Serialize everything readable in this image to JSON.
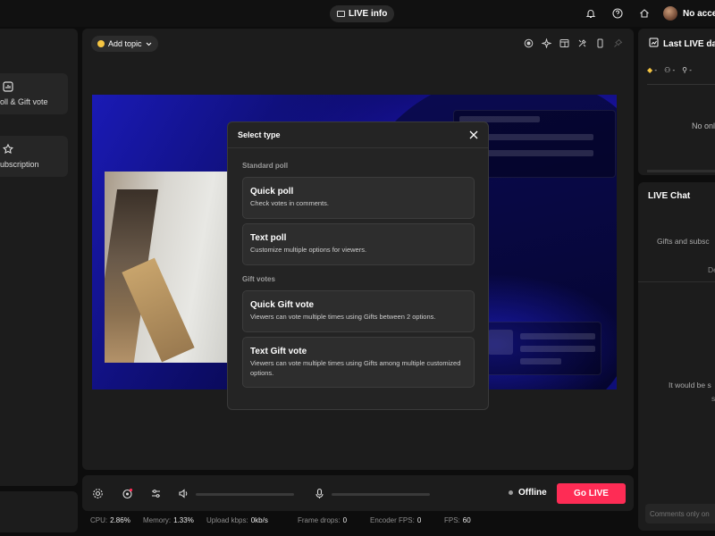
{
  "topbar": {
    "live_info_label": "LIVE info",
    "user_name": "No access"
  },
  "left_panel": {
    "items": [
      {
        "label": "oll & Gift vote",
        "icon": "poll-icon"
      },
      {
        "label": "ubscription",
        "icon": "subscription-icon"
      }
    ]
  },
  "center": {
    "add_topic_label": "Add topic",
    "tools": [
      "record-icon",
      "sparkle-icon",
      "layout-icon",
      "tools-icon",
      "phone-icon",
      "pin-icon"
    ]
  },
  "modal": {
    "title": "Select type",
    "sections": [
      {
        "label": "Standard poll",
        "options": [
          {
            "title": "Quick poll",
            "desc": "Check votes in comments."
          },
          {
            "title": "Text poll",
            "desc": "Customize multiple options for viewers."
          }
        ]
      },
      {
        "label": "Gift votes",
        "options": [
          {
            "title": "Quick Gift vote",
            "desc": "Viewers can vote multiple times using Gifts between 2 options."
          },
          {
            "title": "Text Gift vote",
            "desc": "Viewers can vote multiple times using Gifts among multiple customized options."
          }
        ]
      }
    ]
  },
  "controls": {
    "status": "Offline",
    "go_live": "Go LIVE"
  },
  "stats": {
    "cpu_label": "CPU:",
    "cpu": "2.86%",
    "memory_label": "Memory:",
    "memory": "1.33%",
    "upload_label": "Upload kbps:",
    "upload": "0kb/s",
    "drops_label": "Frame drops:",
    "drops": "0",
    "encoder_label": "Encoder FPS:",
    "encoder": "0",
    "fps_label": "FPS:",
    "fps": "60"
  },
  "right_top": {
    "title": "Last LIVE da",
    "metrics": [
      "-",
      "-",
      "-"
    ],
    "empty_text": "No onl"
  },
  "chat": {
    "title": "LIVE Chat",
    "note1": "Gifts and subsc",
    "note2": "De",
    "note3": "It would be s",
    "note4": "s",
    "input_placeholder": "Comments only on"
  },
  "colors": {
    "accent": "#fe2c55",
    "panel": "#1c1c1c",
    "background": "#0d0d0d"
  }
}
